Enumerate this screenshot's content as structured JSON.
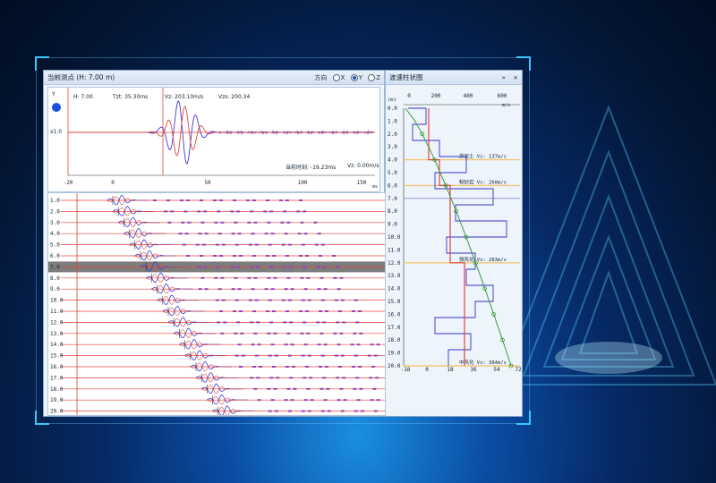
{
  "left_panel": {
    "title": "当前测点 (H: 7.00 m)",
    "direction_label": "方向",
    "radio_x": "X",
    "radio_y": "Y",
    "radio_z": "Z",
    "channel_label": "Y",
    "scale_label": "x1.0",
    "info_h": "H: 7.00",
    "info_tzt": "Tzt: 35.30ms",
    "info_vz1": "Vz: 203.10m/s",
    "info_vzs": "Vzs: 200.34",
    "cursor_time": "当前时刻: -19.23ms",
    "cursor_vz": "Vz: 0.00m/s",
    "time_axis_ticks": [
      "-20",
      "0",
      "50",
      "100",
      "150"
    ],
    "time_axis_unit": "ms",
    "depth_labels": [
      "1.0",
      "2.0",
      "3.0",
      "4.0",
      "5.0",
      "6.0",
      "7.0",
      "8.0",
      "9.0",
      "10.0",
      "11.0",
      "12.0",
      "13.0",
      "14.0",
      "15.0",
      "16.0",
      "17.0",
      "18.0",
      "19.0",
      "20.0"
    ],
    "selected_depth": "7.0"
  },
  "right_panel": {
    "title": "波速柱状图",
    "pin_label": "»",
    "close_label": "×",
    "unit_top": "m/s",
    "depth_unit": "(m)",
    "top_ticks": [
      "0",
      "200",
      "400",
      "600"
    ],
    "bottom_ticks": [
      "-18",
      "0",
      "18",
      "36",
      "54",
      "72"
    ],
    "depth_ticks": [
      "0.0",
      "1.0",
      "2.0",
      "3.0",
      "4.0",
      "5.0",
      "6.0",
      "7.0",
      "8.0",
      "9.0",
      "10.0",
      "11.0",
      "12.0",
      "13.0",
      "14.0",
      "15.0",
      "16.0",
      "17.0",
      "18.0",
      "19.0",
      "20.0"
    ],
    "layers": [
      {
        "label": "淤泥土 Vs: 137m/s"
      },
      {
        "label": "粉砂岩 Vs: 260m/s"
      },
      {
        "label": "强风化 Vs: 283m/s"
      },
      {
        "label": "中风化 Vs: 384m/s"
      }
    ]
  },
  "colors": {
    "trace_blue": "#3a3ad6",
    "trace_red": "#e0453a",
    "trace_purple": "#9a3fb8",
    "highlight_row": "#7d7d7d",
    "layer_line": "#f2c679",
    "velocity_green": "#3a9b3a",
    "marker_blue": "#1c4fe0"
  },
  "icons": {
    "channel_marker": "circle-icon"
  }
}
